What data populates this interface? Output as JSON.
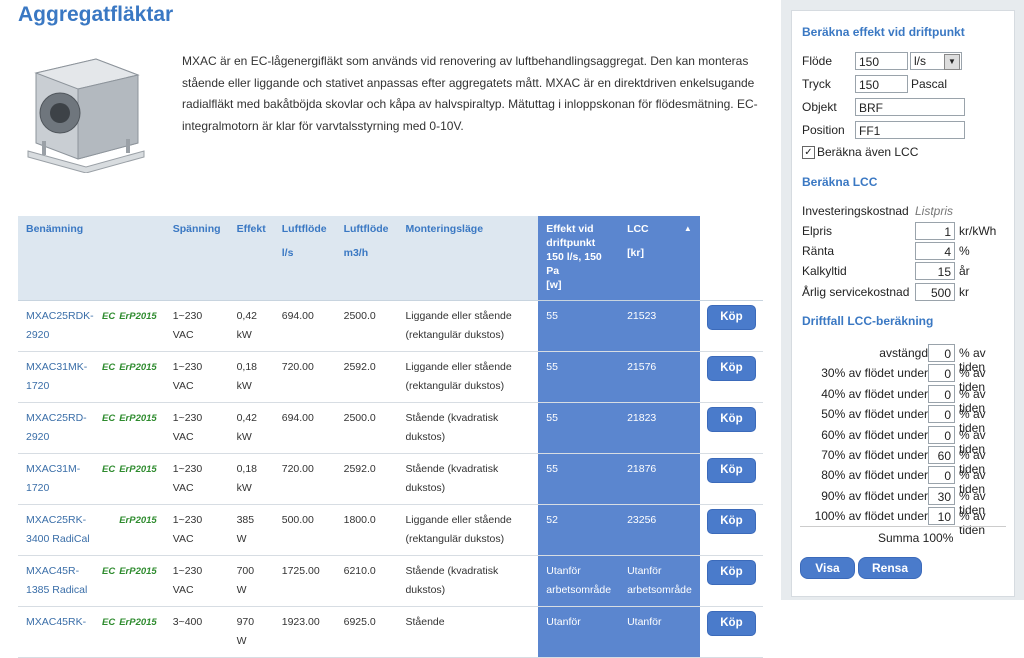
{
  "page": {
    "title": "Aggregatfläktar",
    "description": "MXAC är en EC-lågenergifläkt som används vid renovering av luftbehandlingsaggregat. Den kan monteras stående eller liggande och stativet anpassas efter aggregatets mått. MXAC är en direktdriven enkelsugande radialfläkt med bakåtböjda skovlar och kåpa av halvspiraltyp. Mätuttag i inloppskonan för flödesmätning. EC-integralmotorn är klar för varvtalsstyrning med 0-10V."
  },
  "table": {
    "headers": {
      "name": "Benämning",
      "voltage": "Spänning",
      "power": "Effekt",
      "flow_ls": "Luftflöde",
      "flow_ls_unit": "l/s",
      "flow_m3h": "Luftflöde",
      "flow_m3h_unit": "m3/h",
      "mounting": "Monteringsläge",
      "effect_op": "Effekt vid driftpunkt 150 l/s, 150 Pa",
      "effect_op_unit": "[w]",
      "lcc": "LCC",
      "lcc_unit": "[kr]"
    },
    "ec_label": "EC",
    "erp_label": "ErP2015",
    "buy_label": "Köp",
    "rows": [
      {
        "name": "MXAC25RDK-2920",
        "ec": true,
        "voltage": "1~230 VAC",
        "power": "0,42 kW",
        "flow_ls": "694.00",
        "flow_m3h": "2500.0",
        "mounting": "Liggande eller stående (rektangulär dukstos)",
        "effect": "55",
        "lcc": "21523"
      },
      {
        "name": "MXAC31MK-1720",
        "ec": true,
        "voltage": "1~230 VAC",
        "power": "0,18 kW",
        "flow_ls": "720.00",
        "flow_m3h": "2592.0",
        "mounting": "Liggande eller stående (rektangulär dukstos)",
        "effect": "55",
        "lcc": "21576"
      },
      {
        "name": "MXAC25RD-2920",
        "ec": true,
        "voltage": "1~230 VAC",
        "power": "0,42 kW",
        "flow_ls": "694.00",
        "flow_m3h": "2500.0",
        "mounting": "Stående (kvadratisk dukstos)",
        "effect": "55",
        "lcc": "21823"
      },
      {
        "name": "MXAC31M-1720",
        "ec": true,
        "voltage": "1~230 VAC",
        "power": "0,18 kW",
        "flow_ls": "720.00",
        "flow_m3h": "2592.0",
        "mounting": "Stående (kvadratisk dukstos)",
        "effect": "55",
        "lcc": "21876"
      },
      {
        "name": "MXAC25RK-3400 RadiCal",
        "ec": false,
        "voltage": "1~230 VAC",
        "power": "385 W",
        "flow_ls": "500.00",
        "flow_m3h": "1800.0",
        "mounting": "Liggande eller stående (rektangulär dukstos)",
        "effect": "52",
        "lcc": "23256"
      },
      {
        "name": "MXAC45R-1385 Radical",
        "ec": true,
        "voltage": "1~230 VAC",
        "power": "700 W",
        "flow_ls": "1725.00",
        "flow_m3h": "6210.0",
        "mounting": "Stående (kvadratisk dukstos)",
        "effect": "Utanför arbetsområde",
        "lcc": "Utanför arbetsområde"
      },
      {
        "name": "MXAC45RK-",
        "ec": true,
        "voltage": "3~400",
        "power": "970 W",
        "flow_ls": "1923.00",
        "flow_m3h": "6925.0",
        "mounting": "Stående",
        "effect": "Utanför",
        "lcc": "Utanför"
      }
    ]
  },
  "sidebar": {
    "calc_title": "Beräkna effekt vid driftpunkt",
    "flow_label": "Flöde",
    "flow_value": "150",
    "flow_unit": "l/s",
    "pressure_label": "Tryck",
    "pressure_value": "150",
    "pressure_unit": "Pascal",
    "object_label": "Objekt",
    "object_value": "BRF",
    "position_label": "Position",
    "position_value": "FF1",
    "lcc_checkbox_label": "Beräkna även LCC",
    "lcc_title": "Beräkna LCC",
    "investment_label": "Investeringskostnad",
    "investment_value": "Listpris",
    "elpris_label": "Elpris",
    "elpris_value": "1",
    "elpris_unit": "kr/kWh",
    "ranta_label": "Ränta",
    "ranta_value": "4",
    "ranta_unit": "%",
    "kalkyl_label": "Kalkyltid",
    "kalkyl_value": "15",
    "kalkyl_unit": "år",
    "service_label": "Årlig servicekostnad",
    "service_value": "500",
    "service_unit": "kr",
    "drift_title": "Driftfall LCC-beräkning",
    "drift_unit": "% av tiden",
    "drift": [
      {
        "label": "avstängd",
        "value": "0"
      },
      {
        "label": "30% av flödet under",
        "value": "0"
      },
      {
        "label": "40% av flödet under",
        "value": "0"
      },
      {
        "label": "50% av flödet under",
        "value": "0"
      },
      {
        "label": "60% av flödet under",
        "value": "0"
      },
      {
        "label": "70% av flödet under",
        "value": "60"
      },
      {
        "label": "80% av flödet under",
        "value": "0"
      },
      {
        "label": "90% av flödet under",
        "value": "30"
      },
      {
        "label": "100% av flödet under",
        "value": "10"
      }
    ],
    "summa_label": "Summa 100%",
    "show_button": "Visa",
    "clear_button": "Rensa"
  }
}
